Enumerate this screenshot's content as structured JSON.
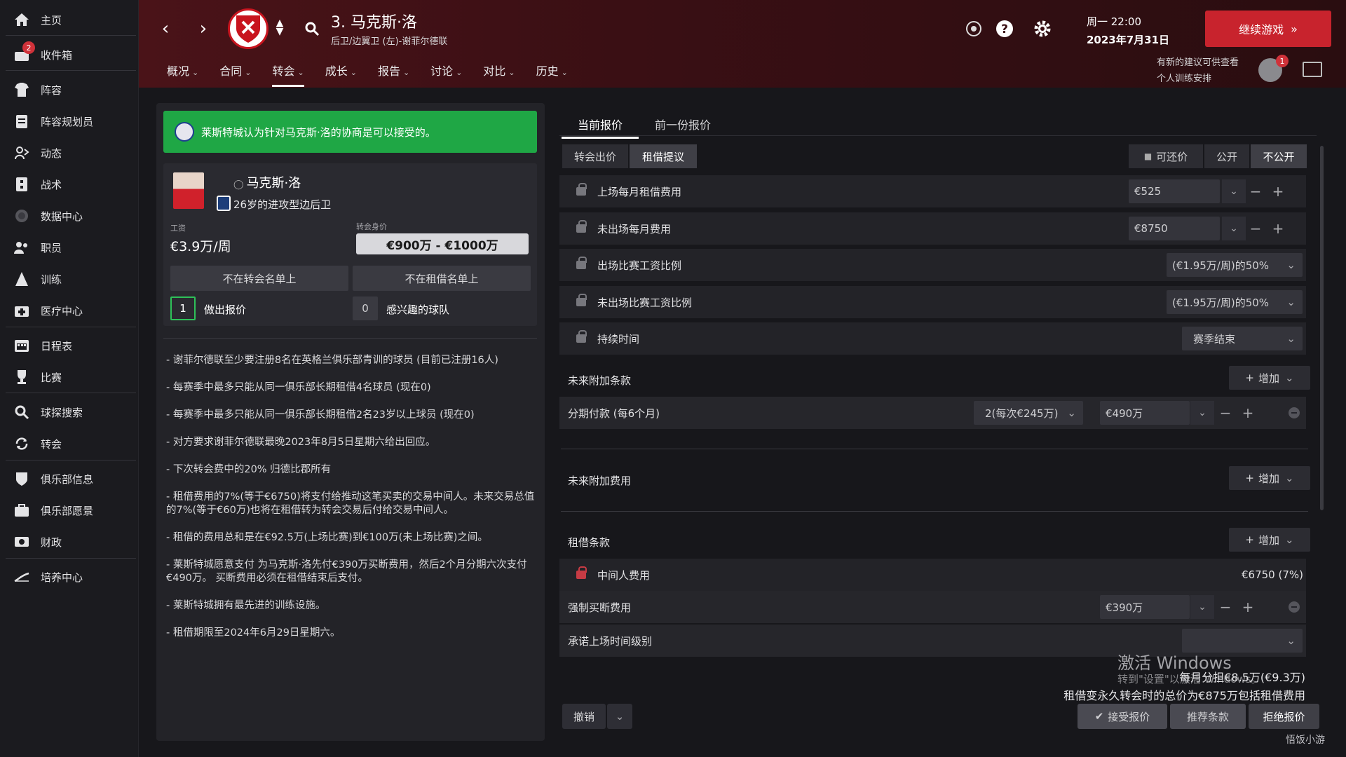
{
  "sidebar": {
    "items": [
      {
        "label": "主页",
        "icon": "home-icon"
      },
      {
        "label": "收件箱",
        "icon": "inbox-icon",
        "badge": "2"
      },
      {
        "label": "阵容",
        "icon": "squad-icon"
      },
      {
        "label": "阵容规划员",
        "icon": "clipboard-icon"
      },
      {
        "label": "动态",
        "icon": "dynamics-icon"
      },
      {
        "label": "战术",
        "icon": "tactics-icon"
      },
      {
        "label": "数据中心",
        "icon": "data-hub-icon"
      },
      {
        "label": "职员",
        "icon": "staff-icon"
      },
      {
        "label": "训练",
        "icon": "training-icon"
      },
      {
        "label": "医疗中心",
        "icon": "medical-icon"
      },
      {
        "label": "日程表",
        "icon": "calendar-icon"
      },
      {
        "label": "比赛",
        "icon": "trophy-icon"
      },
      {
        "label": "球探搜索",
        "icon": "scouting-icon"
      },
      {
        "label": "转会",
        "icon": "transfers-icon"
      },
      {
        "label": "俱乐部信息",
        "icon": "club-info-icon"
      },
      {
        "label": "俱乐部愿景",
        "icon": "club-vision-icon"
      },
      {
        "label": "财政",
        "icon": "finances-icon"
      },
      {
        "label": "培养中心",
        "icon": "development-icon"
      }
    ]
  },
  "header": {
    "player_title": "3. 马克斯·洛",
    "player_subtitle": "后卫/边翼卫 (左)-谢菲尔德联",
    "tabs": [
      {
        "label": "概况"
      },
      {
        "label": "合同"
      },
      {
        "label": "转会"
      },
      {
        "label": "成长"
      },
      {
        "label": "报告"
      },
      {
        "label": "讨论"
      },
      {
        "label": "对比"
      },
      {
        "label": "历史"
      }
    ],
    "active_tab": "转会",
    "day_time": "周一 22:00",
    "date": "2023年7月31日",
    "continue_label": "继续游戏",
    "advice_line1": "有新的建议可供查看",
    "advice_line2": "个人训练安排",
    "advice_badge": "1"
  },
  "left": {
    "banner": "莱斯特城认为针对马克斯·洛的协商是可以接受的。",
    "player_name": "马克斯·洛",
    "player_desc": "26岁的进攻型边后卫",
    "wage_label": "工资",
    "wage_value": "€3.9万/周",
    "value_label": "转会身价",
    "value_range": "€900万 - €1000万",
    "btn_not_transfer_listed": "不在转会名单上",
    "btn_not_loan_listed": "不在租借名单上",
    "offers_count": "1",
    "offers_label": "做出报价",
    "interested_count": "0",
    "interested_label": "感兴趣的球队",
    "notes": [
      "- 谢菲尔德联至少要注册8名在英格兰俱乐部青训的球员 (目前已注册16人)",
      "- 每赛季中最多只能从同一俱乐部长期租借4名球员 (现在0)",
      "- 每赛季中最多只能从同一俱乐部长期租借2名23岁以上球员 (现在0)",
      "- 对方要求谢菲尔德联最晚2023年8月5日星期六给出回应。",
      "- 下次转会费中的20% 归德比郡所有",
      "- 租借费用的7%(等于€6750)将支付给推动这笔买卖的交易中间人。未来交易总值的7%(等于€60万)也将在租借转为转会交易后付给交易中间人。",
      "- 租借的费用总和是在€92.5万(上场比赛)到€100万(未上场比赛)之间。",
      "- 莱斯特城愿意支付 为马克斯·洛先付€390万买断费用，然后2个月分期六次支付€490万。 买断费用必须在租借结束后支付。",
      "- 莱斯特城拥有最先进的训练设施。",
      "- 租借期限至2024年6月29日星期六。"
    ]
  },
  "right": {
    "tab_current": "当前报价",
    "tab_previous": "前一份报价",
    "seg_transfer": "转会出价",
    "seg_loan": "租借提议",
    "seg_negotiable": "可还价",
    "seg_public": "公开",
    "seg_private": "不公开",
    "rows": {
      "monthly_fee_playing_label": "上场每月租借费用",
      "monthly_fee_playing_value": "€525",
      "monthly_fee_not_playing_label": "未出场每月费用",
      "monthly_fee_not_playing_value": "€8750",
      "wage_pct_playing_label": "出场比赛工资比例",
      "wage_pct_playing_value": "(€1.95万/周)的50%",
      "wage_pct_not_playing_label": "未出场比赛工资比例",
      "wage_pct_not_playing_value": "(€1.95万/周)的50%",
      "duration_label": "持续时间",
      "duration_value": "赛季结束"
    },
    "future_clauses_label": "未来附加条款",
    "add_label": "增加",
    "installments_label": "分期付款 (每6个月)",
    "installments_count": "2(每次€245万)",
    "installments_total": "€490万",
    "future_fees_label": "未来附加费用",
    "loan_terms_label": "租借条款",
    "agent_fee_label": "中间人费用",
    "agent_fee_value": "€6750 (7%)",
    "mandatory_buy_label": "强制买断费用",
    "mandatory_buy_value": "€390万",
    "playing_time_label": "承诺上场时间级别",
    "monthly_total": "每月分担€8.5万(€9.3万)",
    "total_summary": "租借变永久转会时的总价为€875万包括租借费用",
    "cancel_label": "撤销",
    "accept_label": "接受报价",
    "suggest_label": "推荐条款",
    "reject_label": "拒绝报价"
  },
  "overlay": {
    "windows_title": "激活 Windows",
    "windows_sub": "转到\"设置\"以激活 Windows。",
    "site_mark": "悟饭小游"
  },
  "colors": {
    "accent_red": "#c8232d",
    "banner_green": "#1fa745",
    "count_green": "#2ec159"
  }
}
